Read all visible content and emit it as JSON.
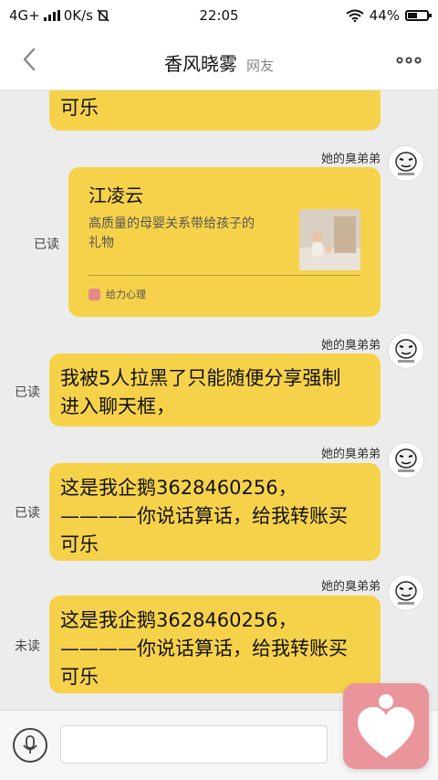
{
  "status_bar": {
    "network": "4G+",
    "speed": "0K/s",
    "time": "22:05",
    "battery": "44%"
  },
  "header": {
    "title": "香风晓雾",
    "tag": "网友"
  },
  "messages": [
    {
      "lines": [
        "可乐"
      ]
    },
    {
      "sender": "她的臭弟弟",
      "read_status": "已读",
      "card": {
        "title": "江凌云",
        "desc_lines": [
          "高质量的母婴关系带给孩子的",
          "礼物"
        ],
        "source": "给力心理"
      }
    },
    {
      "sender": "她的臭弟弟",
      "read_status": "已读",
      "lines": [
        "我被5人拉黑了只能随便分享强制",
        "进入聊天框，"
      ]
    },
    {
      "sender": "她的臭弟弟",
      "read_status": "已读",
      "lines": [
        "这是我企鹅3628460256，",
        "————你说话算话，给我转账买",
        "可乐"
      ]
    },
    {
      "sender": "她的臭弟弟",
      "read_status": "未读",
      "lines": [
        "这是我企鹅3628460256，",
        "————你说话算话，给我转账买",
        "可乐"
      ]
    }
  ],
  "colors": {
    "bubble": "#f6d24a",
    "floating_button": "#e9959b"
  },
  "icons": {
    "back": "chevron-left-icon",
    "more": "more-dots-icon",
    "mic": "microphone-icon",
    "floating": "heart-person-icon"
  }
}
